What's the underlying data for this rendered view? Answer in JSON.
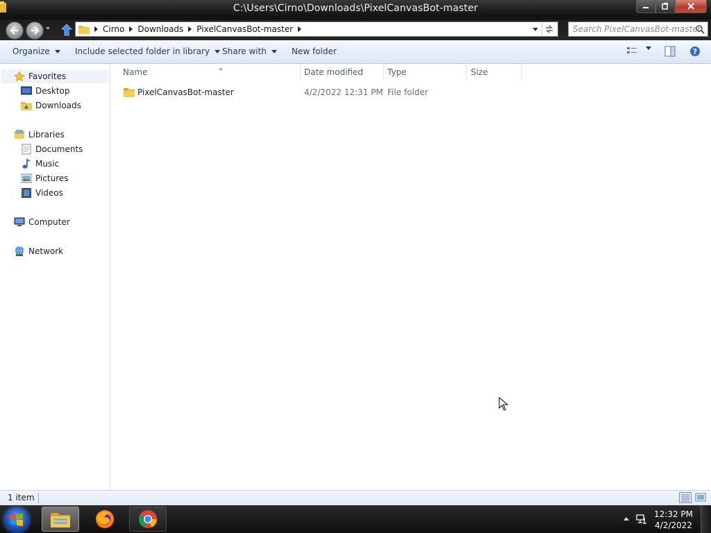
{
  "window": {
    "title": "C:\\Users\\Cirno\\Downloads\\PixelCanvasBot-master",
    "minimize_label": "",
    "maximize_label": "",
    "close_label": ""
  },
  "address": {
    "crumbs": [
      "Cirno",
      "Downloads",
      "PixelCanvasBot-master"
    ],
    "search_placeholder": "Search PixelCanvasBot-master"
  },
  "toolbar": {
    "organize": "Organize",
    "include": "Include selected folder in library",
    "share": "Share with",
    "new_folder": "New folder"
  },
  "nav": {
    "favorites": "Favorites",
    "desktop": "Desktop",
    "downloads": "Downloads",
    "libraries": "Libraries",
    "documents": "Documents",
    "music": "Music",
    "pictures": "Pictures",
    "videos": "Videos",
    "computer": "Computer",
    "network": "Network"
  },
  "columns": {
    "name": "Name",
    "date": "Date modified",
    "type": "Type",
    "size": "Size"
  },
  "files": [
    {
      "name": "PixelCanvasBot-master",
      "date": "4/2/2022 12:31 PM",
      "type": "File folder",
      "size": ""
    }
  ],
  "status": {
    "count": "1 item"
  },
  "taskbar": {
    "time": "12:32 PM",
    "date": "4/2/2022"
  },
  "colors": {
    "accent": "#1e395b",
    "folder": "#e8b830",
    "selection": "#eef3fb"
  }
}
